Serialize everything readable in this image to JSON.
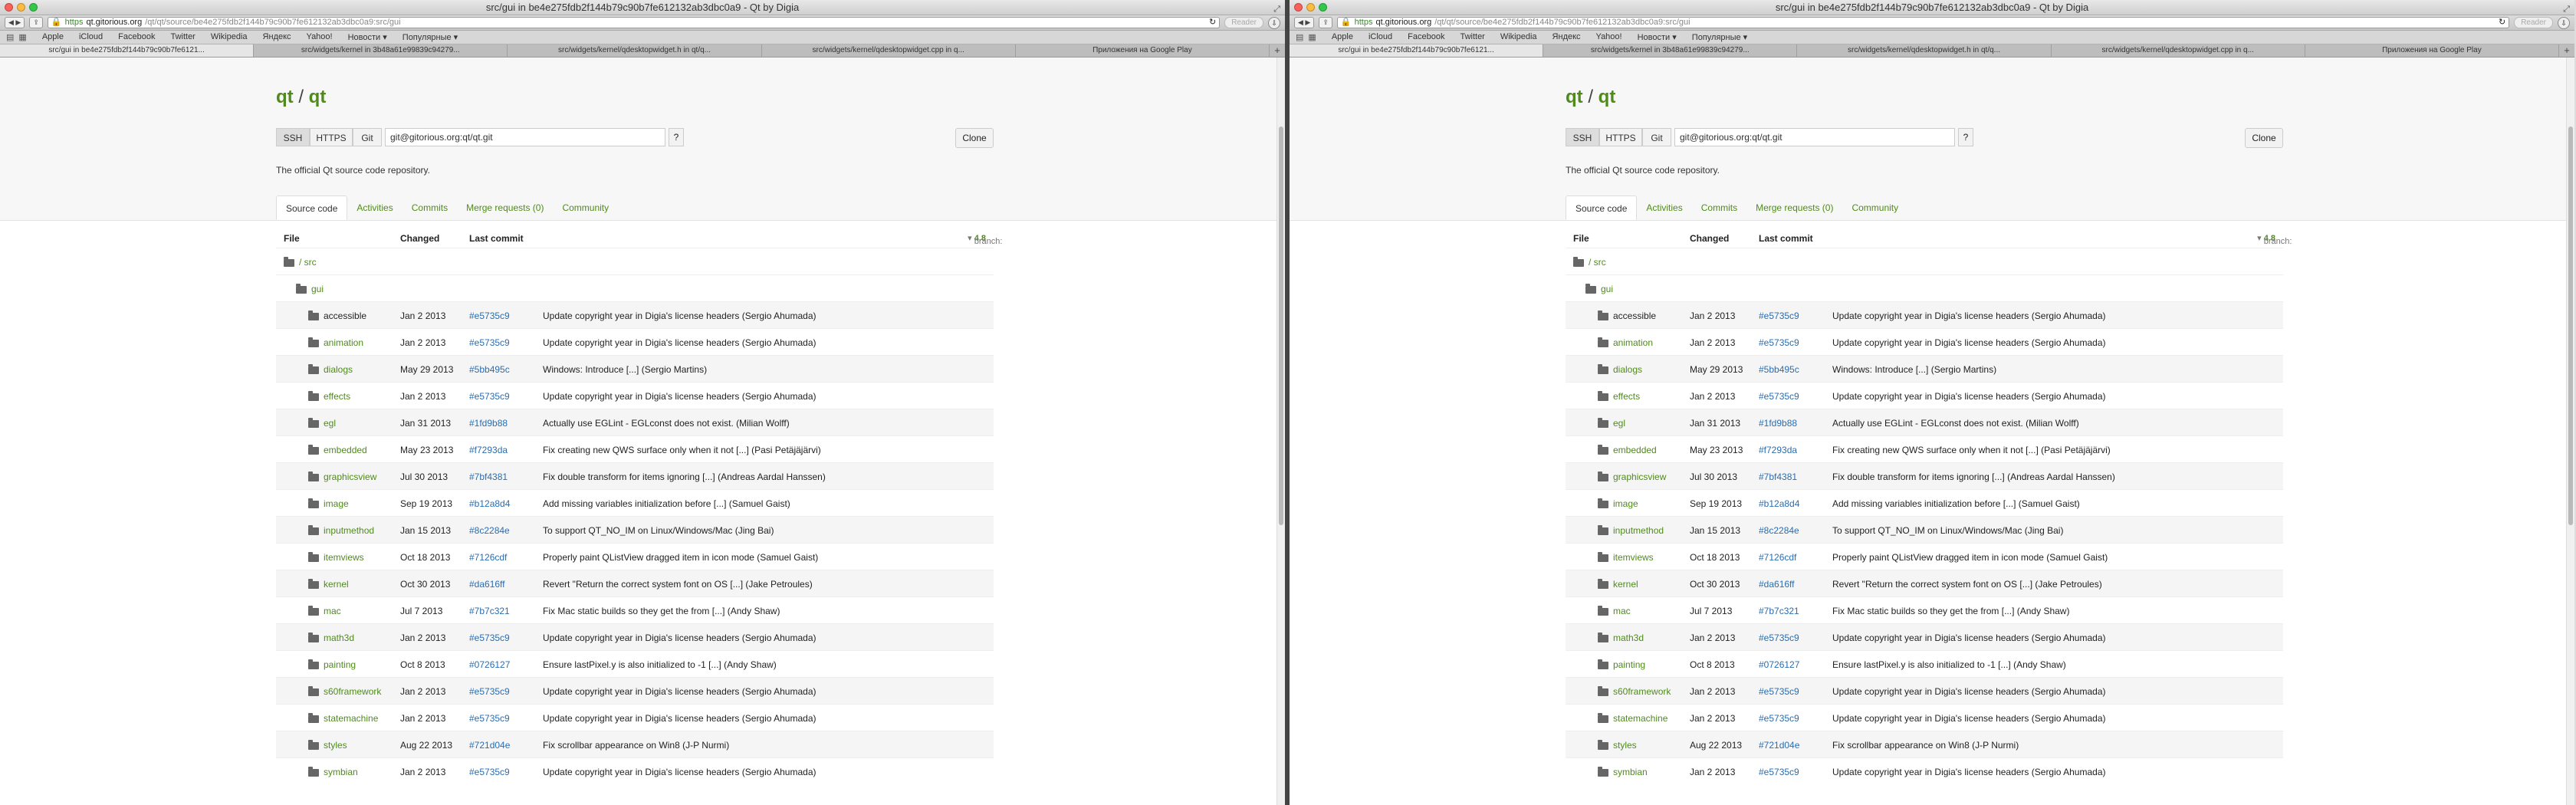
{
  "window": {
    "title": "src/gui in be4e275fdb2f144b79c90b7fe612132ab3dbc0a9 - Qt by Digia",
    "address_scheme": "https",
    "address_host": "qt.gitorious.org",
    "address_path": "/qt/qt/source/be4e275fdb2f144b79c90b7fe612132ab3dbc0a9:src/gui",
    "reader_label": "Reader"
  },
  "bookmarks": [
    "Apple",
    "iCloud",
    "Facebook",
    "Twitter",
    "Wikipedia",
    "Яндекс",
    "Yahoo!",
    "Новости ▾",
    "Популярные ▾"
  ],
  "tabs": [
    "src/gui in be4e275fdb2f144b79c90b7fe6121...",
    "src/widgets/kernel in 3b48a61e99839c94279...",
    "src/widgets/kernel/qdesktopwidget.h in qt/q...",
    "src/widgets/kernel/qdesktopwidget.cpp in q...",
    "Приложения на Google Play"
  ],
  "project": {
    "owner": "qt",
    "name": "qt",
    "protocols": [
      "SSH",
      "HTTPS",
      "Git"
    ],
    "clone_url": "git@gitorious.org:qt/qt.git",
    "help_label": "?",
    "clone_label": "Clone",
    "description": "The official Qt source code repository."
  },
  "nav_tabs": [
    "Source code",
    "Activities",
    "Commits",
    "Merge requests (0)",
    "Community"
  ],
  "tree": {
    "headers": {
      "file": "File",
      "changed": "Changed",
      "last_commit": "Last commit"
    },
    "branch_label": "branch:",
    "branch_name": "4.8",
    "path_root": "/ src",
    "path_dir": "gui",
    "rows": [
      {
        "name": "accessible",
        "date": "Jan 2 2013",
        "sha": "#e5735c9",
        "msg": "Update copyright year in Digia's license headers (Sergio Ahumada)"
      },
      {
        "name": "animation",
        "date": "Jan 2 2013",
        "sha": "#e5735c9",
        "msg": "Update copyright year in Digia's license headers (Sergio Ahumada)"
      },
      {
        "name": "dialogs",
        "date": "May 29 2013",
        "sha": "#5bb495c",
        "msg": "Windows: Introduce [...] (Sergio Martins)"
      },
      {
        "name": "effects",
        "date": "Jan 2 2013",
        "sha": "#e5735c9",
        "msg": "Update copyright year in Digia's license headers (Sergio Ahumada)"
      },
      {
        "name": "egl",
        "date": "Jan 31 2013",
        "sha": "#1fd9b88",
        "msg": "Actually use EGLint - EGLconst does not exist. (Milian Wolff)"
      },
      {
        "name": "embedded",
        "date": "May 23 2013",
        "sha": "#f7293da",
        "msg": "Fix creating new QWS surface only when it not [...] (Pasi Petäjäjärvi)"
      },
      {
        "name": "graphicsview",
        "date": "Jul 30 2013",
        "sha": "#7bf4381",
        "msg": "Fix double transform for items ignoring [...] (Andreas Aardal Hanssen)"
      },
      {
        "name": "image",
        "date": "Sep 19 2013",
        "sha": "#b12a8d4",
        "msg": "Add missing variables initialization before [...] (Samuel Gaist)"
      },
      {
        "name": "inputmethod",
        "date": "Jan 15 2013",
        "sha": "#8c2284e",
        "msg": "To support QT_NO_IM on Linux/Windows/Mac (Jing Bai)"
      },
      {
        "name": "itemviews",
        "date": "Oct 18 2013",
        "sha": "#7126cdf",
        "msg": "Properly paint QListView dragged item in icon mode (Samuel Gaist)"
      },
      {
        "name": "kernel",
        "date": "Oct 30 2013",
        "sha": "#da616ff",
        "msg": "Revert \"Return the correct system font on OS [...] (Jake Petroules)"
      },
      {
        "name": "mac",
        "date": "Jul 7 2013",
        "sha": "#7b7c321",
        "msg": "Fix Mac static builds so they get the from [...] (Andy Shaw)"
      },
      {
        "name": "math3d",
        "date": "Jan 2 2013",
        "sha": "#e5735c9",
        "msg": "Update copyright year in Digia's license headers (Sergio Ahumada)"
      },
      {
        "name": "painting",
        "date": "Oct 8 2013",
        "sha": "#0726127",
        "msg": "Ensure lastPixel.y is also initialized to -1 [...] (Andy Shaw)"
      },
      {
        "name": "s60framework",
        "date": "Jan 2 2013",
        "sha": "#e5735c9",
        "msg": "Update copyright year in Digia's license headers (Sergio Ahumada)"
      },
      {
        "name": "statemachine",
        "date": "Jan 2 2013",
        "sha": "#e5735c9",
        "msg": "Update copyright year in Digia's license headers (Sergio Ahumada)"
      },
      {
        "name": "styles",
        "date": "Aug 22 2013",
        "sha": "#721d04e",
        "msg": "Fix scrollbar appearance on Win8 (J-P Nurmi)"
      },
      {
        "name": "symbian",
        "date": "Jan 2 2013",
        "sha": "#e5735c9",
        "msg": "Update copyright year in Digia's license headers (Sergio Ahumada)"
      }
    ]
  }
}
